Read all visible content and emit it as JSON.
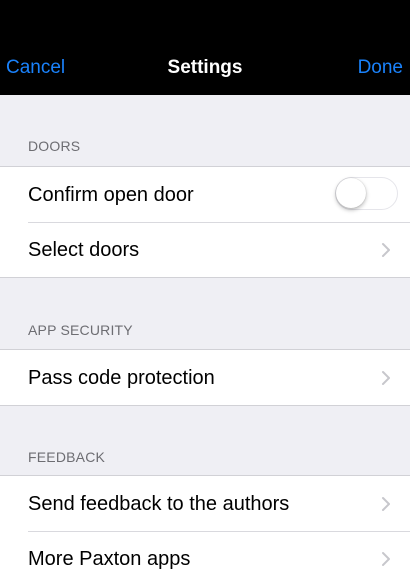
{
  "navbar": {
    "cancel_label": "Cancel",
    "title": "Settings",
    "done_label": "Done",
    "accent_color": "#1a82fb"
  },
  "sections": {
    "doors": {
      "header": "DOORS",
      "confirm_open_door": {
        "label": "Confirm open door",
        "toggle_on": false
      },
      "select_doors": {
        "label": "Select doors",
        "icon": "chevron-right-icon"
      }
    },
    "app_security": {
      "header": "APP SECURITY",
      "pass_code_protection": {
        "label": "Pass code protection",
        "icon": "chevron-right-icon"
      }
    },
    "feedback": {
      "header": "FEEDBACK",
      "send_feedback": {
        "label": "Send feedback to the authors",
        "icon": "chevron-right-icon"
      },
      "more_apps": {
        "label": "More Paxton apps",
        "icon": "chevron-right-icon"
      }
    }
  }
}
